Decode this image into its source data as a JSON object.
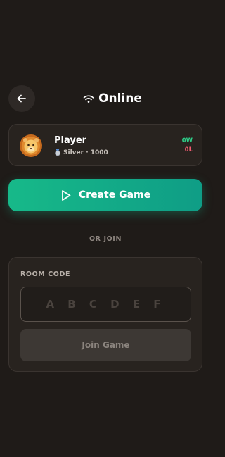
{
  "header": {
    "title": "Online",
    "icons": {
      "back": "arrow-left-icon",
      "status": "wifi-icon"
    }
  },
  "profile": {
    "name": "Player",
    "rank": "Silver · 1000",
    "wins": "0W",
    "losses": "0L",
    "avatar_icon": "lion-icon",
    "rank_icon": "medal-icon"
  },
  "create": {
    "label": "Create Game",
    "icon": "play-icon"
  },
  "divider": {
    "label": "OR JOIN"
  },
  "join": {
    "room_label": "ROOM CODE",
    "placeholder": "A B C D E F",
    "value": "",
    "button_label": "Join Game"
  },
  "colors": {
    "background": "#1f1b18",
    "card": "#28231f",
    "accent_green": "#17b989",
    "wins": "#2ecf8a",
    "losses": "#ef5a6f"
  }
}
